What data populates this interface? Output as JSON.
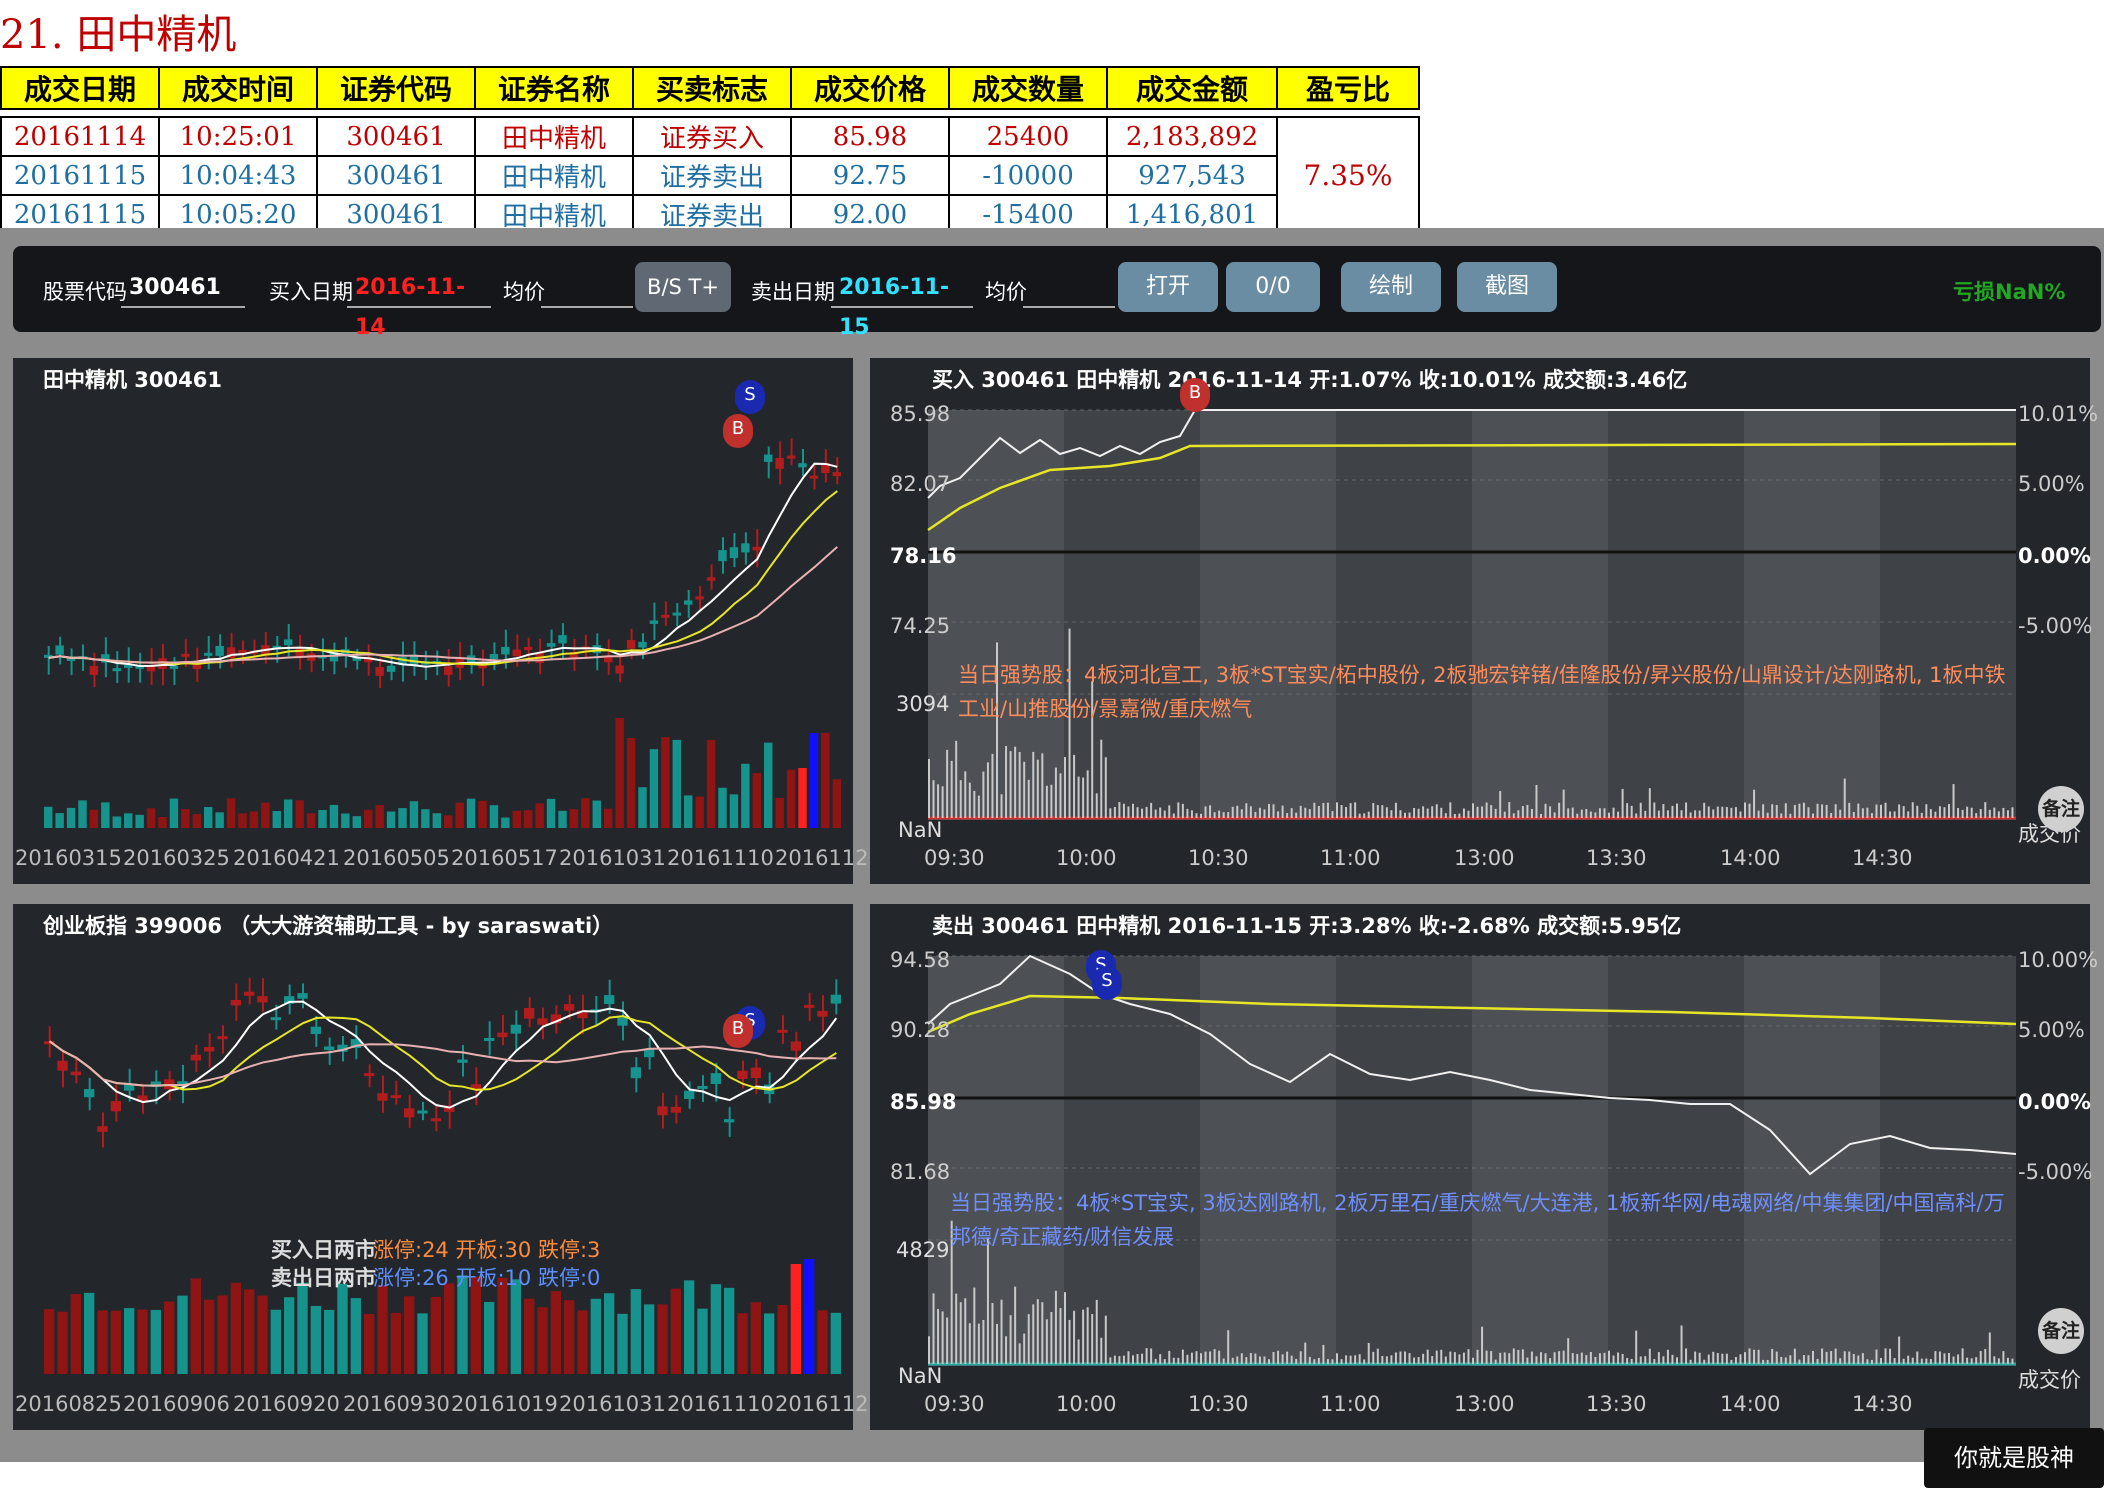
{
  "page_title": "21. 田中精机",
  "trade_table": {
    "headers": [
      "成交日期",
      "成交时间",
      "证券代码",
      "证券名称",
      "买卖标志",
      "成交价格",
      "成交数量",
      "成交金额",
      "盈亏比"
    ],
    "rows": [
      {
        "type": "buy",
        "cells": [
          "20161114",
          "10:25:01",
          "300461",
          "田中精机",
          "证券买入",
          "85.98",
          "25400",
          "2,183,892"
        ]
      },
      {
        "type": "sell",
        "cells": [
          "20161115",
          "10:04:43",
          "300461",
          "田中精机",
          "证券卖出",
          "92.75",
          "-10000",
          "927,543"
        ]
      },
      {
        "type": "sell",
        "cells": [
          "20161115",
          "10:05:20",
          "300461",
          "田中精机",
          "证券卖出",
          "92.00",
          "-15400",
          "1,416,801"
        ]
      }
    ],
    "ratio": "7.35%"
  },
  "toolbar": {
    "code_label": "股票代码",
    "code_value": "300461",
    "buy_date_label": "买入日期",
    "buy_date_value": "2016-11-14",
    "avg_label_1": "均价",
    "bst_button": "B/S T+",
    "sell_date_label": "卖出日期",
    "sell_date_value": "2016-11-15",
    "avg_label_2": "均价",
    "open_button": "打开",
    "count_button": "0/0",
    "draw_button": "绘制",
    "screenshot_button": "截图",
    "pnl_text": "亏损NaN%",
    "colors": {
      "buy_date": "#ff2020",
      "sell_date": "#33e0ff",
      "pnl": "#22a822",
      "button": "#6b8da3",
      "bst": "#5f6873"
    }
  },
  "panels": {
    "stock_daily": {
      "title": "田中精机 300461",
      "x_ticks": [
        "20160315",
        "20160325",
        "20160421",
        "20160505",
        "20160517",
        "20161031",
        "20161110",
        "2016112"
      ],
      "buy_marker": "B",
      "sell_marker": "S"
    },
    "index_daily": {
      "title": "创业板指 399006   （大大游资辅助工具 - by saraswati）",
      "x_ticks": [
        "20160825",
        "20160906",
        "20160920",
        "20160930",
        "20161019",
        "20161031",
        "20161110",
        "2016112"
      ],
      "buy_market_label": "买入日两市",
      "buy_market_stats": "涨停:24 开板:30 跌停:3",
      "sell_market_label": "卖出日两市",
      "sell_market_stats": "涨停:26 开板:10 跌停:0",
      "buy_marker": "B",
      "sell_marker": "S"
    },
    "buy_intraday": {
      "title": "买入 300461 田中精机 2016-11-14 开:1.07% 收:10.01% 成交额:3.46亿",
      "y_left": [
        "85.98",
        "82.07",
        "78.16",
        "74.25",
        "3094",
        "NaN"
      ],
      "y_right": [
        "10.01%",
        "5.00%",
        "0.00%",
        "-5.00%",
        "成交价"
      ],
      "x_ticks": [
        "09:30",
        "10:00",
        "10:30",
        "11:00",
        "13:00",
        "13:30",
        "14:00",
        "14:30"
      ],
      "strong_stocks": "当日强势股：4板河北宣工, 3板*ST宝实/柘中股份, 2板驰宏锌锗/佳隆股份/昇兴股份/山鼎设计/达刚路机, 1板中铁工业/山推股份/景嘉微/重庆燃气",
      "note_button": "备注",
      "buy_marker": "B"
    },
    "sell_intraday": {
      "title": "卖出 300461 田中精机 2016-11-15 开:3.28% 收:-2.68% 成交额:5.95亿",
      "y_left": [
        "94.58",
        "90.28",
        "85.98",
        "81.68",
        "4829",
        "NaN"
      ],
      "y_right": [
        "10.00%",
        "5.00%",
        "0.00%",
        "-5.00%",
        "成交价"
      ],
      "x_ticks": [
        "09:30",
        "10:00",
        "10:30",
        "11:00",
        "13:00",
        "13:30",
        "14:00",
        "14:30"
      ],
      "strong_stocks": "当日强势股：4板*ST宝实, 3板达刚路机, 2板万里石/重庆燃气/大连港, 1板新华网/电魂网络/中集集团/中国高科/万邦德/奇正藏药/财信发展",
      "note_button": "备注",
      "sell_marker": "S"
    }
  },
  "watermark": "你就是股神"
}
